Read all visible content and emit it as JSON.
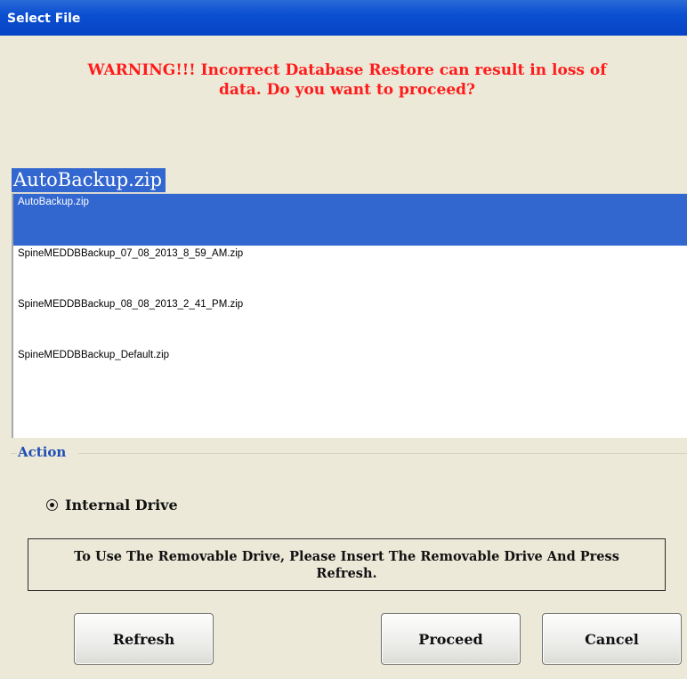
{
  "window": {
    "title": "Select File"
  },
  "warning": {
    "line1": "WARNING!!! Incorrect Database Restore can result in loss of",
    "line2": "data. Do you want to proceed?"
  },
  "selected_file": "AutoBackup.zip",
  "file_list": [
    {
      "name": "AutoBackup.zip",
      "selected": true
    },
    {
      "name": "SpineMEDDBBackup_07_08_2013_8_59_AM.zip",
      "selected": false
    },
    {
      "name": "SpineMEDDBBackup_08_08_2013_2_41_PM.zip",
      "selected": false
    },
    {
      "name": "SpineMEDDBBackup_Default.zip",
      "selected": false
    }
  ],
  "action": {
    "legend": "Action",
    "radio_label": "Internal Drive",
    "radio_checked": true
  },
  "info": {
    "line1": "To Use The Removable Drive, Please Insert The Removable Drive And Press",
    "line2": "Refresh."
  },
  "buttons": {
    "refresh": "Refresh",
    "proceed": "Proceed",
    "cancel": "Cancel"
  },
  "colors": {
    "titlebar": "#0b4fd1",
    "selection": "#3367d0",
    "warning": "#ff1b1b",
    "legend": "#1f4fb5",
    "background": "#ece9d8"
  }
}
